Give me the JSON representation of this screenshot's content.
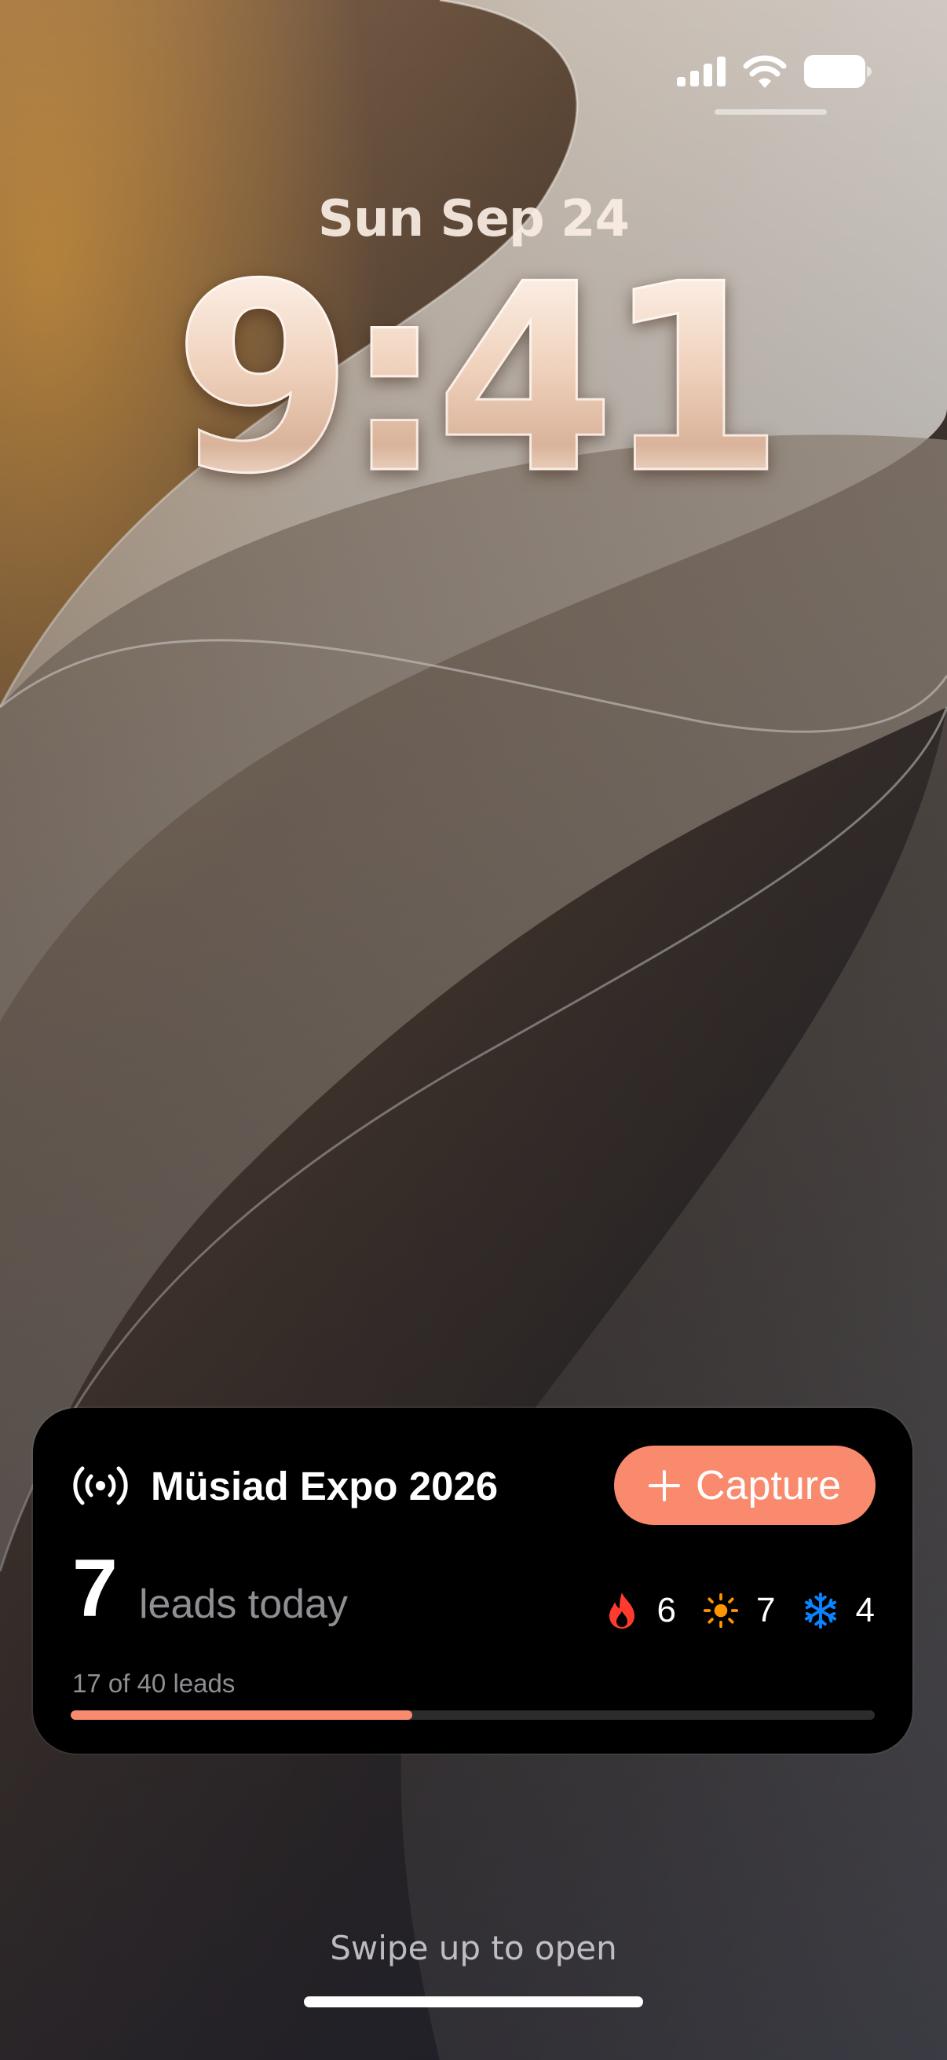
{
  "status_bar": {
    "signal_icon": "cellular-signal-icon",
    "wifi_icon": "wifi-icon",
    "battery_icon": "battery-icon"
  },
  "lock_screen": {
    "date": "Sun Sep 24",
    "time": "9:41"
  },
  "live_activity": {
    "icon": "broadcast-icon",
    "event_name": "Müsiad Expo 2026",
    "capture_label": "Capture",
    "leads_today_count": "7",
    "leads_today_label": "leads today",
    "temperatures": [
      {
        "icon": "flame-icon",
        "count": "6",
        "color": "#ff3b30"
      },
      {
        "icon": "sun-icon",
        "count": "7",
        "color": "#ff9500"
      },
      {
        "icon": "snowflake-icon",
        "count": "4",
        "color": "#0a84ff"
      }
    ],
    "progress_label": "17 of 40 leads",
    "progress": {
      "current": 17,
      "total": 40
    },
    "accent_color": "#f98a6e"
  },
  "footer": {
    "swipe_hint": "Swipe up to open"
  }
}
